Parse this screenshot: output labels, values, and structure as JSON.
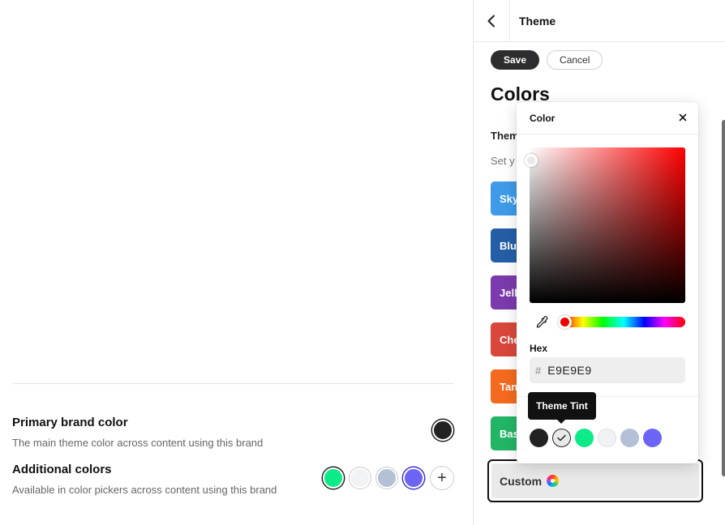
{
  "brand": {
    "primary_title": "Primary brand color",
    "primary_desc": "The main theme color across content using this brand",
    "primary_color": "#222222",
    "additional_title": "Additional colors",
    "additional_desc": "Available in color pickers across content using this brand",
    "additional_colors": [
      "#0ceb87",
      "#f1f2f4",
      "#b3c0d6",
      "#6b64f5"
    ],
    "add_icon": "plus-icon"
  },
  "panel": {
    "back_icon": "chevron-left-icon",
    "title": "Theme",
    "save_label": "Save",
    "cancel_label": "Cancel",
    "section_title": "Colors",
    "sub_heading": "Theme",
    "sub_desc": "Set y",
    "themes": [
      {
        "label": "Sky",
        "color": "#3f9be8"
      },
      {
        "label": "Blu",
        "color": "#245ea6"
      },
      {
        "label": "Jell",
        "color": "#7b3aad"
      },
      {
        "label": "Che",
        "color": "#d9473b"
      },
      {
        "label": "Tan",
        "color": "#f46a1f"
      },
      {
        "label": "Bas",
        "color": "#23b566"
      }
    ],
    "custom_label": "Custom",
    "custom_icon": "color-wheel-icon"
  },
  "picker": {
    "title": "Color",
    "close_icon": "close-icon",
    "eyedropper_icon": "eyedropper-icon",
    "hex_label": "Hex",
    "hex_hash": "#",
    "hex_value": "E9E9E9",
    "tooltip": "Theme Tint",
    "swatches": [
      {
        "name": "dark",
        "color": "#222222"
      },
      {
        "name": "theme-tint",
        "color": "#e9e9e9",
        "selected": true
      },
      {
        "name": "green",
        "color": "#0ceb87"
      },
      {
        "name": "off-white",
        "color": "#f1f2f4"
      },
      {
        "name": "slate",
        "color": "#b3c0d6"
      },
      {
        "name": "violet",
        "color": "#6b64f5"
      }
    ]
  }
}
